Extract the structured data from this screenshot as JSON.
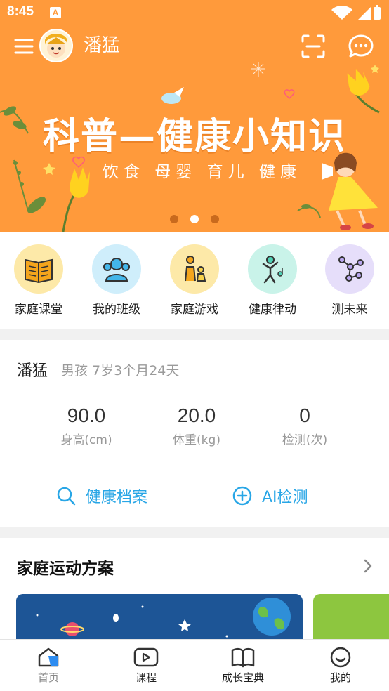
{
  "status_bar": {
    "time": "8:45",
    "notification_icon": "a-icon"
  },
  "header": {
    "username": "潘猛",
    "icons": [
      "menu-icon",
      "avatar",
      "scan-icon",
      "message-icon"
    ]
  },
  "banner": {
    "title": "科普—健康小知识",
    "subtitle": "饮食 母婴 育儿 健康",
    "page_count": 3,
    "active_page": 2
  },
  "quick_entries": [
    {
      "label": "家庭课堂",
      "icon": "book-icon",
      "bg": "#fde9a8"
    },
    {
      "label": "我的班级",
      "icon": "group-icon",
      "bg": "#cfeefb"
    },
    {
      "label": "家庭游戏",
      "icon": "parent-child-icon",
      "bg": "#fde9a8"
    },
    {
      "label": "健康律动",
      "icon": "dance-icon",
      "bg": "#c9f3e9"
    },
    {
      "label": "测未来",
      "icon": "network-icon",
      "bg": "#e6defa"
    }
  ],
  "profile": {
    "name": "潘猛",
    "meta": "男孩 7岁3个月24天",
    "stats": [
      {
        "value": "90.0",
        "label": "身高(cm)"
      },
      {
        "value": "20.0",
        "label": "体重(kg)"
      },
      {
        "value": "0",
        "label": "检测(次)"
      }
    ],
    "actions": [
      {
        "label": "健康档案",
        "icon": "search-icon"
      },
      {
        "label": "AI检测",
        "icon": "plus-circle-icon"
      }
    ]
  },
  "plan": {
    "title": "家庭运动方案"
  },
  "bottom_nav": [
    {
      "label": "首页",
      "icon": "home-icon",
      "active": true
    },
    {
      "label": "课程",
      "icon": "play-icon",
      "active": false
    },
    {
      "label": "成长宝典",
      "icon": "book-open-icon",
      "active": false
    },
    {
      "label": "我的",
      "icon": "smile-icon",
      "active": false
    }
  ],
  "colors": {
    "accent_orange": "#ff9a3b",
    "link_blue": "#28a6e6",
    "nav_active_blue": "#2d8cf0"
  }
}
